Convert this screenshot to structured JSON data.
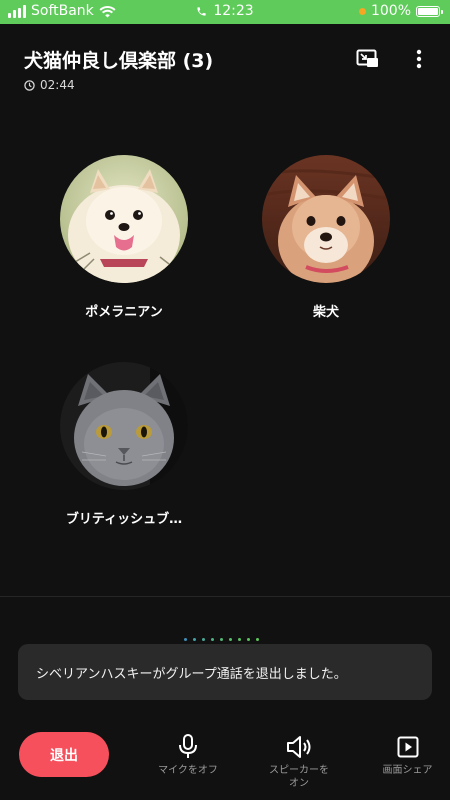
{
  "status_bar": {
    "carrier": "SoftBank",
    "time": "12:23",
    "battery": "100%",
    "battery_level": 1.0
  },
  "header": {
    "title": "犬猫仲良し倶楽部 (3)",
    "duration": "02:44"
  },
  "icons": {
    "timer": "clock-icon",
    "minimize": "minimize-window-icon",
    "more": "more-vertical-icon"
  },
  "participants": [
    {
      "name": "ポメラニアン",
      "avatar": "pomeranian-photo"
    },
    {
      "name": "柴犬",
      "avatar": "shiba-inu-photo"
    },
    {
      "name": "ブリティッシュブ…",
      "avatar": "british-shorthair-photo"
    }
  ],
  "toast": {
    "message": "シベリアンハスキーがグループ通話を退出しました。"
  },
  "controls": {
    "leave_label": "退出",
    "mic_label": "マイクをオフ",
    "speaker_label": "スピーカーを\nオン",
    "screen_share_label": "画面シェア"
  },
  "colors": {
    "status_bar": "#5ecb5a",
    "background": "#111111",
    "leave_button": "#f5505c",
    "toast_background": "#2a2a2a"
  }
}
